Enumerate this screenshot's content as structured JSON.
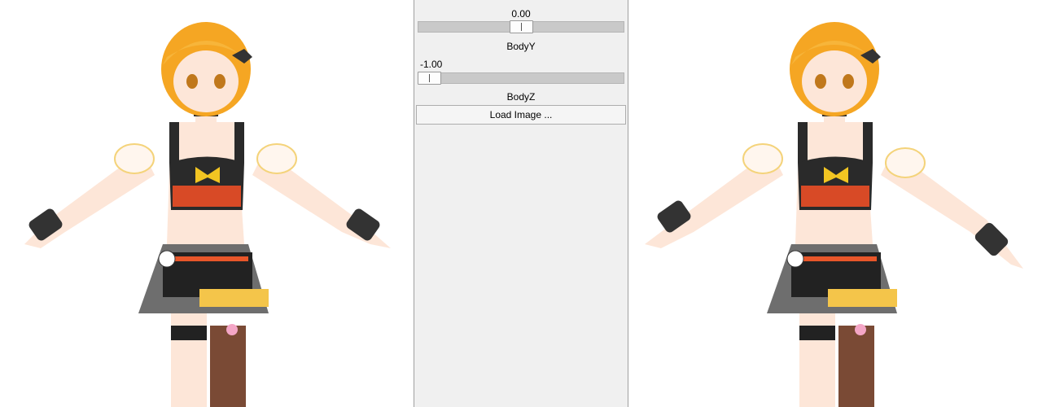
{
  "controls": {
    "top_value": "0.00",
    "body_y": {
      "label": "BodyY",
      "value_text": "-1.00",
      "slider_position": 0.0
    },
    "top_slider_position": 0.5,
    "body_z": {
      "label": "BodyZ"
    },
    "load_button_label": "Load Image ..."
  },
  "viewports": {
    "left": {
      "content": "anime character model render (input image)"
    },
    "right": {
      "content": "anime character model render (posed output)"
    }
  },
  "colors": {
    "panel_bg": "#f0f0f0",
    "hair": "#f5a623",
    "outfit_black": "#2a2a2a",
    "skin": "#fde6d8",
    "accent_orange": "#e8562a"
  }
}
